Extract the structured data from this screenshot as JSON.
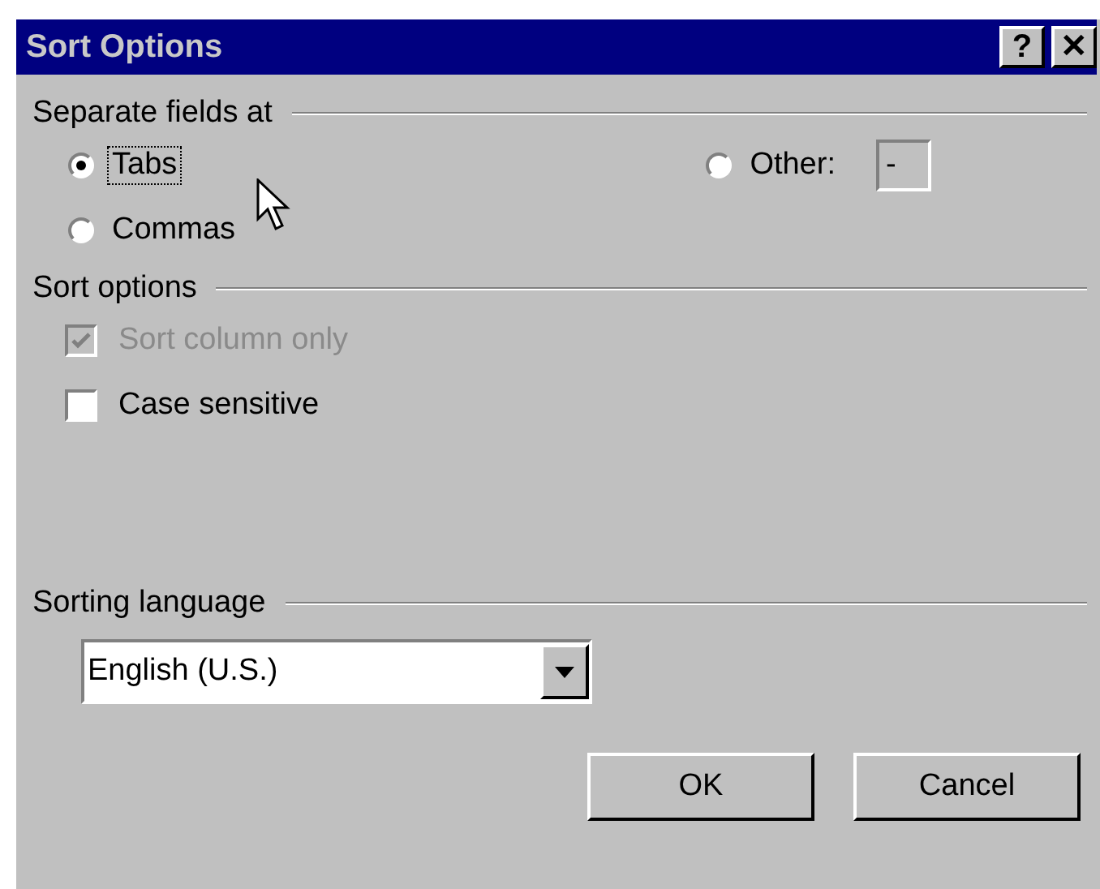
{
  "window": {
    "title": "Sort Options",
    "title_buttons": [
      "?",
      "✕"
    ]
  },
  "separate_group": {
    "label": "Separate fields at",
    "options": [
      {
        "label": "Tabs",
        "selected": true,
        "focused": true
      },
      {
        "label": "Commas",
        "selected": false,
        "focused": false
      }
    ],
    "other": {
      "label": "Other:",
      "selected": false,
      "value": "-"
    }
  },
  "sort_group": {
    "label": "Sort options",
    "options": [
      {
        "label": "Sort column only",
        "checked": true,
        "disabled": true
      },
      {
        "label": "Case sensitive",
        "checked": false,
        "disabled": false
      }
    ]
  },
  "language_group": {
    "label": "Sorting language",
    "value": "English (U.S.)"
  },
  "buttons": [
    "OK",
    "Cancel"
  ]
}
